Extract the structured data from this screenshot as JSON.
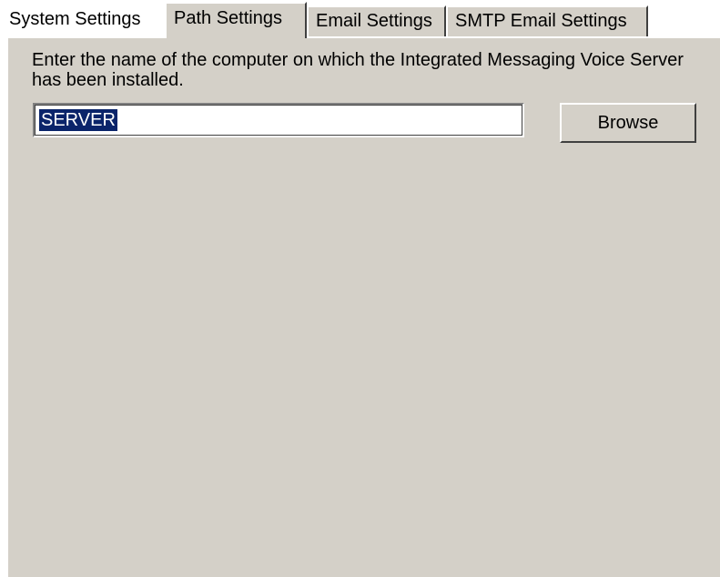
{
  "tabs": [
    {
      "label": "System Settings",
      "active": false
    },
    {
      "label": "Path Settings",
      "active": true
    },
    {
      "label": "Email Settings",
      "active": false
    },
    {
      "label": "SMTP Email Settings",
      "active": false
    }
  ],
  "path_settings": {
    "prompt": "Enter the name of the computer on which the Integrated Messaging Voice Server has been installed.",
    "server_field_value": "SERVER",
    "browse_label": "Browse"
  },
  "colors": {
    "panel_bg": "#d4d0c8",
    "selection_bg": "#0a246a",
    "selection_text": "#ffffff"
  }
}
